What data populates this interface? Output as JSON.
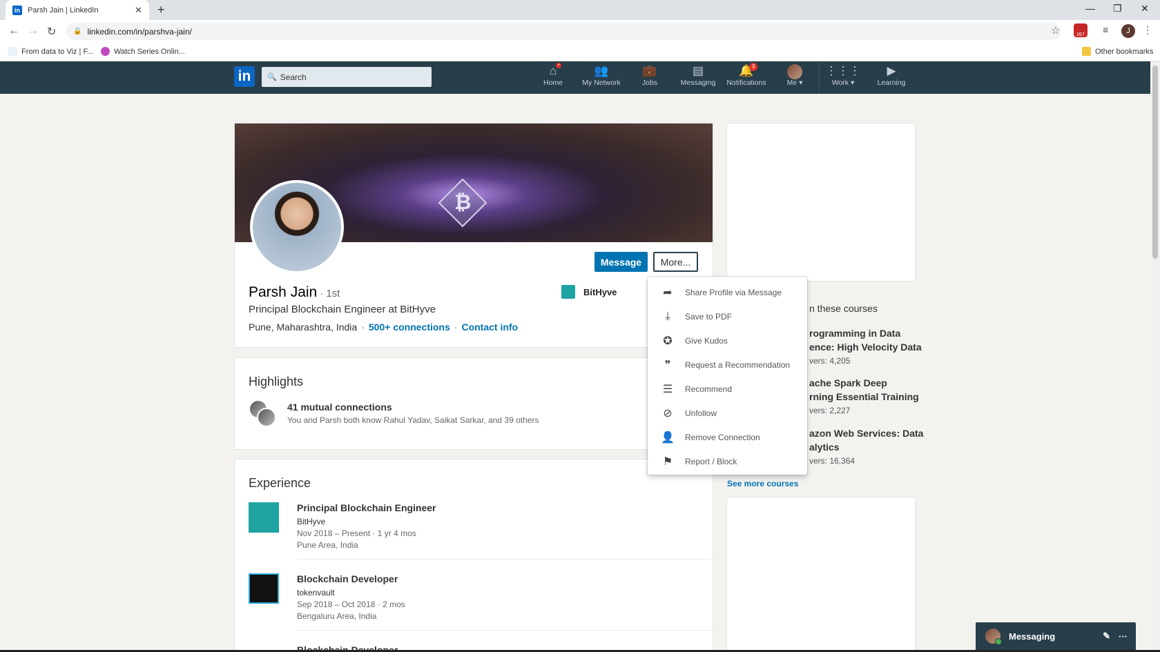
{
  "browser": {
    "tab_title": "Parsh Jain | LinkedIn",
    "tab_close": "✕",
    "new_tab": "+",
    "url": "linkedin.com/in/parshva-jain/",
    "bookmarks": [
      "From data to Viz | F...",
      "Watch Series Onlin..."
    ],
    "other_bookmarks": "Other bookmarks",
    "ext_badge": "267",
    "profile_initial": "J"
  },
  "nav": {
    "search_placeholder": "Search",
    "items": [
      {
        "label": "Home",
        "badge": "•"
      },
      {
        "label": "My Network"
      },
      {
        "label": "Jobs"
      },
      {
        "label": "Messaging"
      },
      {
        "label": "Notifications",
        "badge": "3"
      },
      {
        "label": "Me ▾"
      },
      {
        "label": "Work ▾"
      },
      {
        "label": "Learning"
      }
    ]
  },
  "profile": {
    "name": "Parsh Jain",
    "degree": "· 1st",
    "headline": "Principal Blockchain Engineer at BitHyve",
    "location": "Pune, Maharashtra, India",
    "connections": "500+ connections",
    "contact": "Contact info",
    "company": "BitHyve",
    "message_btn": "Message",
    "more_btn": "More..."
  },
  "highlights": {
    "title": "Highlights",
    "mutual_title": "41 mutual connections",
    "mutual_sub": "You and Parsh both know Rahul Yadav, Saikat Sarkar, and 39 others"
  },
  "experience": {
    "title": "Experience",
    "items": [
      {
        "title": "Principal Blockchain Engineer",
        "company": "BitHyve",
        "dates": "Nov 2018 – Present · 1 yr 4 mos",
        "location": "Pune Area, India"
      },
      {
        "title": "Blockchain Developer",
        "company": "tokenvault",
        "dates": "Sep 2018 – Oct 2018 · 2 mos",
        "location": "Bengaluru Area, India"
      },
      {
        "title": "Blockchain Developer"
      }
    ]
  },
  "courses": {
    "title": "n these courses",
    "items": [
      {
        "line1": "rogramming in Data",
        "line2": "ence: High Velocity Data",
        "viewers": "vers: 4,205"
      },
      {
        "line1": "ache Spark Deep",
        "line2": "rning Essential Training",
        "viewers": "vers: 2,227"
      },
      {
        "line1": "azon Web Services: Data",
        "line2": "alytics",
        "viewers": "vers: 16,364"
      }
    ],
    "see_more": "See more courses"
  },
  "dropdown": {
    "items": [
      {
        "label": "Share Profile via Message",
        "icon": "share-arrow-icon"
      },
      {
        "label": "Save to PDF",
        "icon": "download-icon"
      },
      {
        "label": "Give Kudos",
        "icon": "award-icon"
      },
      {
        "label": "Request a Recommendation",
        "icon": "quote-icon"
      },
      {
        "label": "Recommend",
        "icon": "comment-icon"
      },
      {
        "label": "Unfollow",
        "icon": "block-icon"
      },
      {
        "label": "Remove Connection",
        "icon": "remove-user-icon"
      },
      {
        "label": "Report / Block",
        "icon": "flag-icon"
      }
    ]
  },
  "messaging": {
    "label": "Messaging"
  },
  "colors": {
    "linkedin_blue": "#0073b1",
    "header_bg": "#283e4a"
  }
}
